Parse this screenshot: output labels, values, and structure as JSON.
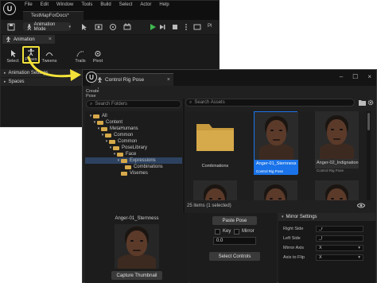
{
  "main_window": {
    "logo": "U",
    "menu": [
      "File",
      "Edit",
      "Window",
      "Tools",
      "Build",
      "Select",
      "Actor",
      "Help"
    ],
    "map_tab": "TestMapForDocs*",
    "mode_label": "Animation Mode",
    "mode_icon": "running-figure-icon",
    "play_label": "Pl",
    "panel_tab": "Animation",
    "tools": [
      {
        "label": "Select",
        "icon": "select-arrow-icon"
      },
      {
        "label": "Poses",
        "icon": "pose-figure-icon"
      },
      {
        "label": "Tweens",
        "icon": "tween-icon"
      },
      {
        "label": "Trails",
        "icon": "trails-icon"
      },
      {
        "label": "Pivot",
        "icon": "pivot-icon"
      }
    ],
    "sections": [
      "Animation Settings",
      "Spaces"
    ]
  },
  "pose_window": {
    "tab_title": "Control Rig Pose",
    "create_pose": "Create Pose",
    "folder_search_placeholder": "Search Folders",
    "asset_search_placeholder": "Search Assets",
    "tree": [
      {
        "label": "All",
        "depth": 0,
        "selected": false
      },
      {
        "label": "Content",
        "depth": 1,
        "selected": false
      },
      {
        "label": "MetaHumans",
        "depth": 2,
        "selected": false
      },
      {
        "label": "Common",
        "depth": 3,
        "selected": false
      },
      {
        "label": "Common",
        "depth": 4,
        "selected": false
      },
      {
        "label": "PoseLibrary",
        "depth": 5,
        "selected": false
      },
      {
        "label": "Face",
        "depth": 6,
        "selected": false
      },
      {
        "label": "Expressions",
        "depth": 7,
        "selected": true
      },
      {
        "label": "Combinations",
        "depth": 8,
        "selected": false
      },
      {
        "label": "Visemes",
        "depth": 7,
        "selected": false
      }
    ],
    "assets": [
      {
        "name": "Combinations",
        "kind": "",
        "type": "folder",
        "selected": false
      },
      {
        "name": "Anger-01_Sternness",
        "kind": "Control Rig Pose",
        "type": "pose",
        "selected": true
      },
      {
        "name": "Anger-02_Indignation",
        "kind": "Control Rig Pose",
        "type": "pose",
        "selected": false
      }
    ],
    "status": "25 items (1 selected)",
    "view_options_icon": "eye-icon",
    "preview": {
      "name": "Anger-01_Sternness",
      "capture_button": "Capture Thumbnail"
    },
    "controls": {
      "paste_button": "Paste Pose",
      "key_label": "Key",
      "mirror_label": "Mirror",
      "blend_value": "0.0",
      "select_button": "Select Controls"
    },
    "mirror_settings": {
      "title": "Mirror Settings",
      "rows": [
        {
          "label": "Right Side",
          "value": "_r",
          "has_dropdown": false
        },
        {
          "label": "Left Side",
          "value": "_l",
          "has_dropdown": false
        },
        {
          "label": "Mirror Axis",
          "value": "X",
          "has_dropdown": true
        },
        {
          "label": "Axis to Flip",
          "value": "X",
          "has_dropdown": true
        }
      ]
    }
  },
  "colors": {
    "highlight": "#f2e23a",
    "selection": "#1a73e8",
    "folder": "#d6a94a",
    "play": "#3fb950"
  }
}
